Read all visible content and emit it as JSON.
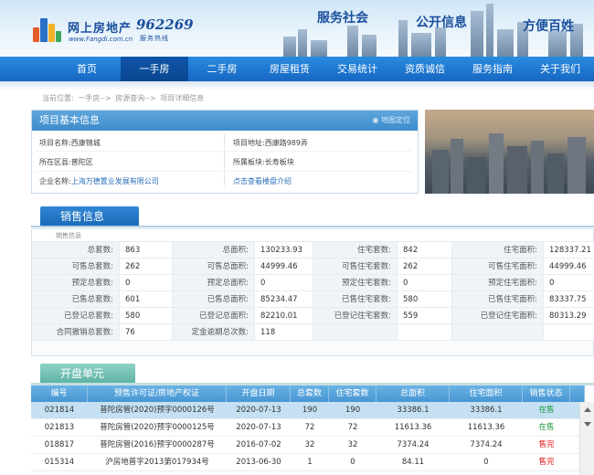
{
  "header": {
    "logo_text": "网上房地产",
    "logo_url": "www.Fangdi.com.cn",
    "hotline": "962269",
    "hotline_sub": "服务热线",
    "slogans": [
      "服务社会",
      "公开信息",
      "方便百姓"
    ]
  },
  "nav": {
    "items": [
      "首页",
      "一手房",
      "二手房",
      "房屋租赁",
      "交易统计",
      "资质诚信",
      "服务指南",
      "关于我们"
    ],
    "active_index": 1
  },
  "breadcrumb": [
    "当前位置:",
    "一手房-->",
    "房源查询-->",
    "项目详细信息"
  ],
  "project": {
    "title": "项目基本信息",
    "map_link": "地图定位",
    "name_label": "项目名称:",
    "name": "西康锦城",
    "address_label": "项目地址:",
    "address": "西康路989弄",
    "district_label": "所在区县:",
    "district": "普陀区",
    "plate_label": "所属板块:",
    "plate": "长寿板块",
    "company_label": "企业名称:",
    "company": "上海万德置业发展有限公司",
    "intro_link": "点击查看楼盘介绍"
  },
  "sales": {
    "tab": "销售信息",
    "caption": "销售信息",
    "rows": [
      [
        [
          "总套数:",
          "863"
        ],
        [
          "总面积:",
          "130233.93"
        ],
        [
          "住宅套数:",
          "842"
        ],
        [
          "住宅面积:",
          "128337.21"
        ]
      ],
      [
        [
          "可售总套数:",
          "262"
        ],
        [
          "可售总面积:",
          "44999.46"
        ],
        [
          "可售住宅套数:",
          "262"
        ],
        [
          "可售住宅面积:",
          "44999.46"
        ]
      ],
      [
        [
          "预定总套数:",
          "0"
        ],
        [
          "预定总面积:",
          "0"
        ],
        [
          "预定住宅套数:",
          "0"
        ],
        [
          "预定住宅面积:",
          "0"
        ]
      ],
      [
        [
          "已售总套数:",
          "601"
        ],
        [
          "已售总面积:",
          "85234.47"
        ],
        [
          "已售住宅套数:",
          "580"
        ],
        [
          "已售住宅面积:",
          "83337.75"
        ]
      ],
      [
        [
          "已登记总套数:",
          "580"
        ],
        [
          "已登记总面积:",
          "82210.01"
        ],
        [
          "已登记住宅套数:",
          "559"
        ],
        [
          "已登记住宅面积:",
          "80313.29"
        ]
      ],
      [
        [
          "合同撤销总套数:",
          "76"
        ],
        [
          "定金逾期总次数:",
          "118"
        ],
        [
          "",
          ""
        ],
        [
          "",
          ""
        ]
      ]
    ]
  },
  "units": {
    "tab": "开盘单元",
    "headers": [
      "编号",
      "预售许可证/房地产权证",
      "开盘日期",
      "总套数",
      "住宅套数",
      "总面积",
      "住宅面积",
      "销售状态"
    ],
    "rows": [
      [
        "021814",
        "普陀房管(2020)预字0000126号",
        "2020-07-13",
        "190",
        "190",
        "33386.1",
        "33386.1",
        "在售"
      ],
      [
        "021813",
        "普陀房管(2020)预字0000125号",
        "2020-07-13",
        "72",
        "72",
        "11613.36",
        "11613.36",
        "在售"
      ],
      [
        "018817",
        "普陀房管(2016)预字0000287号",
        "2016-07-02",
        "32",
        "32",
        "7374.24",
        "7374.24",
        "售完"
      ],
      [
        "015314",
        "沪房地普字2013第017934号",
        "2013-06-30",
        "1",
        "0",
        "84.11",
        "0",
        "售完"
      ]
    ]
  },
  "colors": {
    "nav_blue": "#1a6fc8",
    "on_sale": "#1a9a3a",
    "sold_out": "#e31a1a"
  }
}
